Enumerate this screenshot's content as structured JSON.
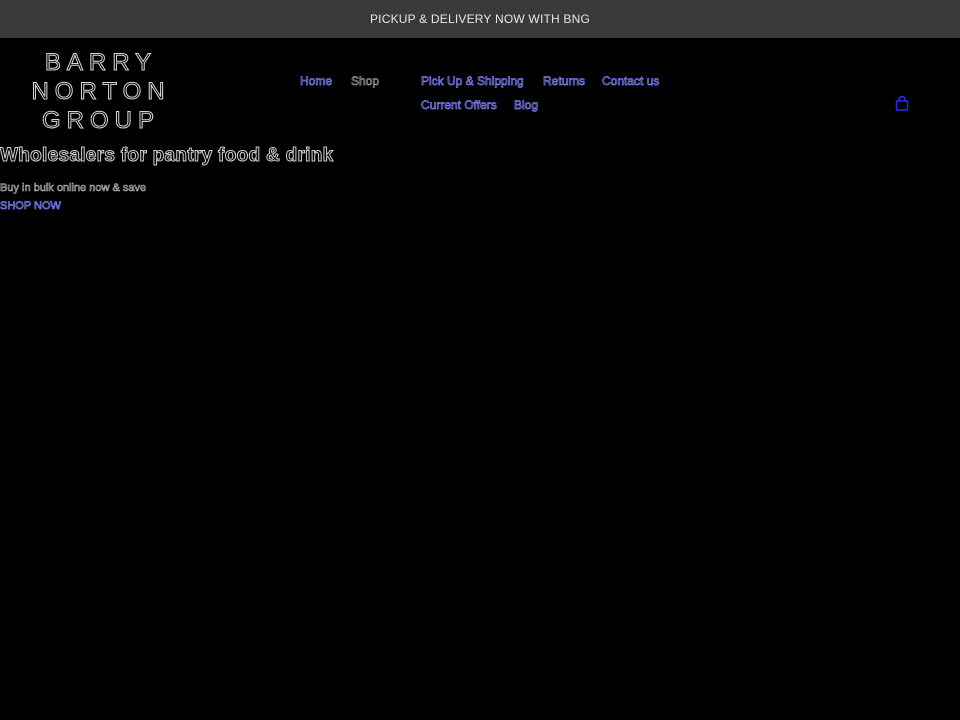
{
  "announcement": {
    "text": "PICKUP & DELIVERY NOW WITH BNG"
  },
  "logo": {
    "lines": [
      "BARRY",
      "NORTON",
      "GROUP"
    ]
  },
  "nav": {
    "items": [
      {
        "label": "Home"
      },
      {
        "label": "Shop"
      },
      {
        "label": "Pick Up & Shipping"
      },
      {
        "label": "Returns"
      },
      {
        "label": "Contact us"
      },
      {
        "label": "Current Offers"
      },
      {
        "label": "Blog"
      }
    ]
  },
  "cart": {
    "icon": "cart-icon"
  },
  "hero": {
    "title": "Wholesalers for pantry food & drink",
    "subtitle": "Buy in bulk online now & save",
    "cta": "SHOP NOW"
  },
  "colors": {
    "background": "#000000",
    "announcement_bg": "#3a3a3a",
    "link": "#8080ff",
    "cart": "#2a2aff"
  }
}
